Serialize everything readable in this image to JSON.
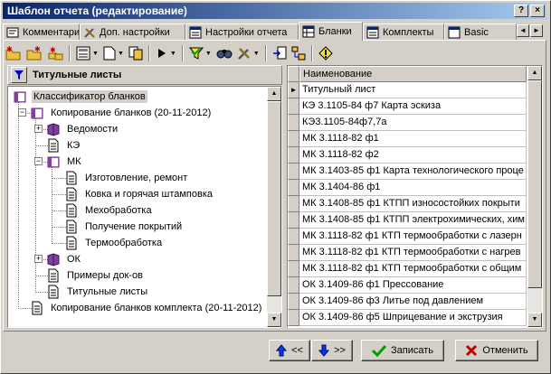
{
  "window": {
    "title": "Шаблон отчета (редактирование)",
    "controls": [
      "?",
      "×"
    ]
  },
  "tabs": [
    {
      "label": "Комментарий",
      "icon": "comment-icon",
      "active": false
    },
    {
      "label": "Доп. настройки",
      "icon": "tools-icon",
      "active": false
    },
    {
      "label": "Настройки отчета",
      "icon": "report-settings-icon",
      "active": false
    },
    {
      "label": "Бланки",
      "icon": "forms-icon",
      "active": true
    },
    {
      "label": "Комплекты",
      "icon": "sets-icon",
      "active": false
    },
    {
      "label": "Basic",
      "icon": "basic-icon",
      "active": false
    }
  ],
  "tab_scroll": {
    "left": "◄",
    "right": "►"
  },
  "toolbar": {
    "drop_glyph": "▼",
    "icons": [
      "add-folder-icon",
      "add-subfolder-icon",
      "add-item-icon",
      "save-list-icon",
      "page-icon",
      "copy-icon",
      "run-icon",
      "filter-icon",
      "find-icon",
      "tools-icon",
      "export-icon",
      "tree-icon",
      "info-icon"
    ]
  },
  "left_panel": {
    "title": "Титульные листы",
    "tree": [
      {
        "label": "Классификатор бланков",
        "level": 0,
        "icon": "book-icon",
        "expander": "",
        "selected": true
      },
      {
        "label": "Копирование бланков  (20-11-2012)",
        "level": 1,
        "icon": "book-icon",
        "expander": "−"
      },
      {
        "label": "Ведомости",
        "level": 2,
        "icon": "book-purple-icon",
        "expander": "+"
      },
      {
        "label": "КЭ",
        "level": 2,
        "icon": "document-icon",
        "expander": ""
      },
      {
        "label": "МК",
        "level": 2,
        "icon": "book-icon",
        "expander": "−"
      },
      {
        "label": "Изготовление, ремонт",
        "level": 3,
        "icon": "document-icon",
        "expander": ""
      },
      {
        "label": "Ковка и горячая штамповка",
        "level": 3,
        "icon": "document-icon",
        "expander": ""
      },
      {
        "label": "Мехобработка",
        "level": 3,
        "icon": "document-icon",
        "expander": ""
      },
      {
        "label": "Получение покрытий",
        "level": 3,
        "icon": "document-icon",
        "expander": ""
      },
      {
        "label": "Термообработка",
        "level": 3,
        "icon": "document-icon",
        "expander": ""
      },
      {
        "label": "ОК",
        "level": 2,
        "icon": "book-purple-icon",
        "expander": "+"
      },
      {
        "label": "Примеры док-ов",
        "level": 2,
        "icon": "document-icon",
        "expander": ""
      },
      {
        "label": "Титульные листы",
        "level": 2,
        "icon": "document-icon",
        "expander": ""
      },
      {
        "label": "Копирование бланков комплекта (20-11-2012)",
        "level": 1,
        "icon": "document-icon",
        "expander": ""
      }
    ]
  },
  "grid": {
    "header": "Наименование",
    "current_marker": "►",
    "rows": [
      "Титульный лист",
      "КЭ 3.1105-84 ф7 Карта эскиза",
      "КЭ3.1105-84ф7,7а",
      "МК 3.1118-82 ф1",
      "МК 3.1118-82 ф2",
      "МК 3.1403-85 ф1 Карта технологического проце",
      "МК 3.1404-86 ф1",
      "МК 3.1408-85 ф1 КТПП износостойких покрыти",
      "МК 3.1408-85 ф1 КТПП электрохимических, хим",
      "МК 3.1118-82 ф1 КТП термообработки с лазерн",
      "МК 3.1118-82 ф1 КТП термообработки с нагрев",
      "МК 3.1118-82 ф1 КТП термообработки с общим",
      "ОК 3.1409-86 ф1 Прессование",
      "ОК 3.1409-86 ф3 Литье под давлением",
      "ОК 3.1409-86 ф5 Шприцевание и экструзия"
    ]
  },
  "buttons": {
    "up": "<<",
    "down": ">>",
    "save": "Записать",
    "cancel": "Отменить"
  },
  "scroll_arrows": {
    "up": "▲",
    "down": "▼"
  }
}
